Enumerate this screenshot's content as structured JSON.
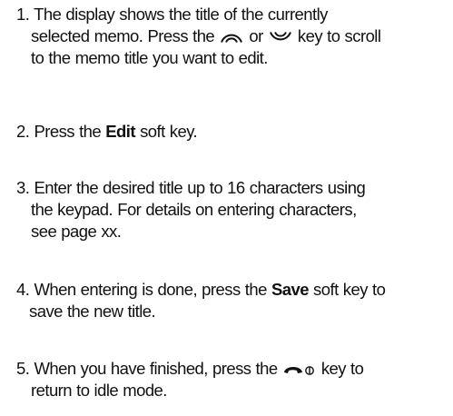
{
  "steps": [
    {
      "number": "1.",
      "parts": {
        "text_a": "The display shows the title of the currently",
        "text_b": "selected memo. Press the",
        "or": "or",
        "text_c": "key to scroll",
        "text_d": "to the memo title you want to edit."
      },
      "icons": [
        "scroll-up-key-icon",
        "scroll-down-key-icon"
      ]
    },
    {
      "number": "2.",
      "parts": {
        "text_a": "Press the",
        "bold": "Edit",
        "text_b": "soft key."
      }
    },
    {
      "number": "3.",
      "parts": {
        "text_a": "Enter the desired title up to 16 characters using",
        "text_b": "the keypad. For details on entering characters,",
        "text_c": "see page xx."
      }
    },
    {
      "number": "4.",
      "parts": {
        "text_a": "When entering is done, press the",
        "bold": "Save",
        "text_b": "soft key to",
        "text_c": "save the new title."
      }
    },
    {
      "number": "5.",
      "parts": {
        "text_a": "When you have finished, press the",
        "text_b": "key to",
        "text_c": "return to idle mode."
      },
      "icons": [
        "end-power-key-icon"
      ]
    }
  ]
}
